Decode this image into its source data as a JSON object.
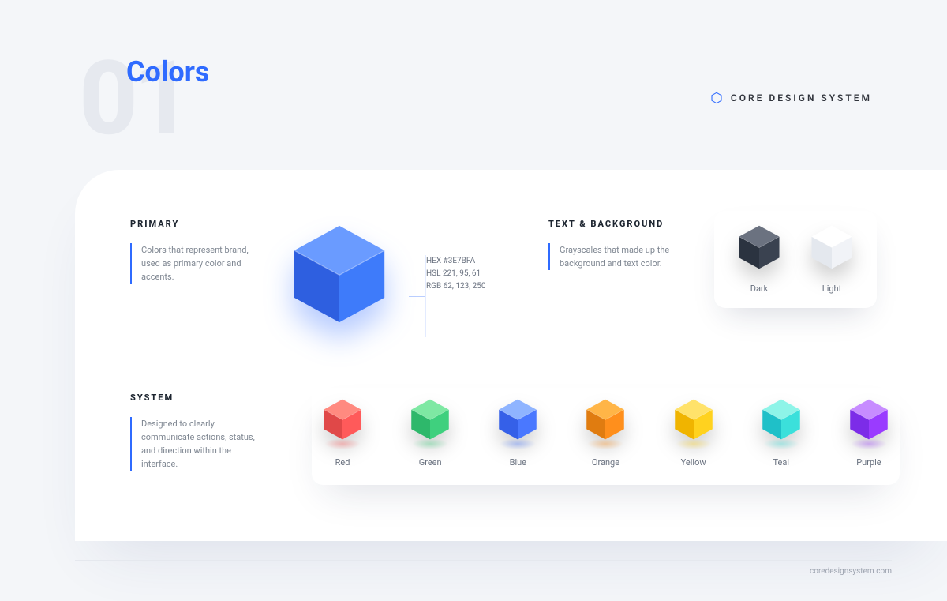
{
  "page": {
    "number": "01",
    "title": "Colors",
    "brand": "CORE DESIGN SYSTEM",
    "footer_url": "coredesignsystem.com"
  },
  "sections": {
    "primary": {
      "label": "PRIMARY",
      "description": "Colors that represent brand, used as primary color and accents.",
      "color": {
        "hex_line": "HEX #3E7BFA",
        "hsl_line": "HSL 221, 95, 61",
        "rgb_line": "RGB 62, 123, 250",
        "hex": "#3E7BFA",
        "top": "#6A9BFF",
        "left": "#2E5FE0",
        "right": "#3E7BFA"
      }
    },
    "text_background": {
      "label": "TEXT & BACKGROUND",
      "description": "Grayscales that made up the background and text color.",
      "swatches": [
        {
          "name": "Dark",
          "top": "#6B7280",
          "left": "#2B3340",
          "right": "#3A4250"
        },
        {
          "name": "Light",
          "top": "#FFFFFF",
          "left": "#E4E8EE",
          "right": "#F1F3F7"
        }
      ]
    },
    "system": {
      "label": "SYSTEM",
      "description": "Designed to clearly communicate actions, status, and direction within the interface.",
      "swatches": [
        {
          "name": "Red",
          "top": "#FF8A80",
          "left": "#E04848",
          "right": "#FF5A5A"
        },
        {
          "name": "Green",
          "top": "#7EE8A3",
          "left": "#2EB86B",
          "right": "#3FD07E"
        },
        {
          "name": "Blue",
          "top": "#8FB4FF",
          "left": "#3560E8",
          "right": "#4A78FF"
        },
        {
          "name": "Orange",
          "top": "#FFB547",
          "left": "#E07C10",
          "right": "#FF8F1C"
        },
        {
          "name": "Yellow",
          "top": "#FFE26A",
          "left": "#F0B400",
          "right": "#FFD21F"
        },
        {
          "name": "Teal",
          "top": "#8EF4E8",
          "left": "#1FC0C8",
          "right": "#3BE0DB"
        },
        {
          "name": "Purple",
          "top": "#C78CFF",
          "left": "#7C2CE8",
          "right": "#9A3BFF"
        }
      ]
    }
  }
}
